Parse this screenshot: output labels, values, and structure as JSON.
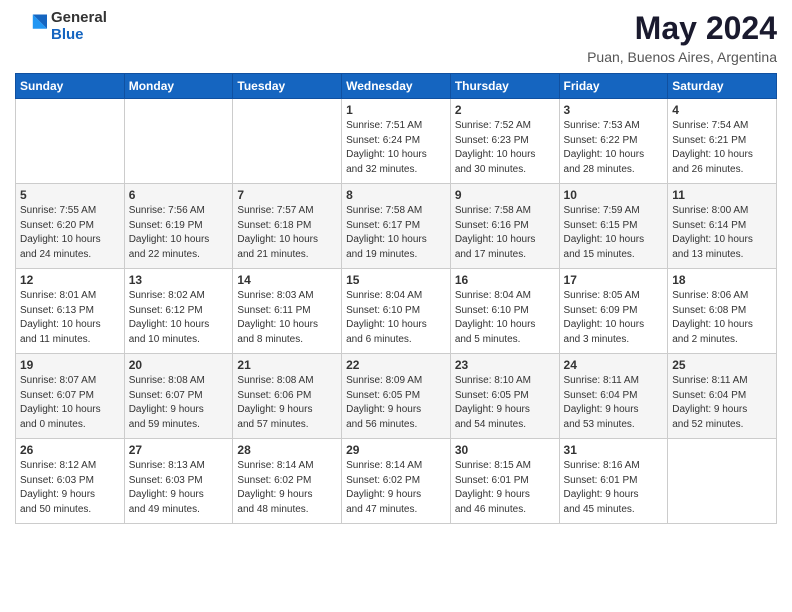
{
  "logo": {
    "general": "General",
    "blue": "Blue"
  },
  "title": "May 2024",
  "location": "Puan, Buenos Aires, Argentina",
  "days_of_week": [
    "Sunday",
    "Monday",
    "Tuesday",
    "Wednesday",
    "Thursday",
    "Friday",
    "Saturday"
  ],
  "weeks": [
    [
      {
        "day": "",
        "info": ""
      },
      {
        "day": "",
        "info": ""
      },
      {
        "day": "",
        "info": ""
      },
      {
        "day": "1",
        "info": "Sunrise: 7:51 AM\nSunset: 6:24 PM\nDaylight: 10 hours\nand 32 minutes."
      },
      {
        "day": "2",
        "info": "Sunrise: 7:52 AM\nSunset: 6:23 PM\nDaylight: 10 hours\nand 30 minutes."
      },
      {
        "day": "3",
        "info": "Sunrise: 7:53 AM\nSunset: 6:22 PM\nDaylight: 10 hours\nand 28 minutes."
      },
      {
        "day": "4",
        "info": "Sunrise: 7:54 AM\nSunset: 6:21 PM\nDaylight: 10 hours\nand 26 minutes."
      }
    ],
    [
      {
        "day": "5",
        "info": "Sunrise: 7:55 AM\nSunset: 6:20 PM\nDaylight: 10 hours\nand 24 minutes."
      },
      {
        "day": "6",
        "info": "Sunrise: 7:56 AM\nSunset: 6:19 PM\nDaylight: 10 hours\nand 22 minutes."
      },
      {
        "day": "7",
        "info": "Sunrise: 7:57 AM\nSunset: 6:18 PM\nDaylight: 10 hours\nand 21 minutes."
      },
      {
        "day": "8",
        "info": "Sunrise: 7:58 AM\nSunset: 6:17 PM\nDaylight: 10 hours\nand 19 minutes."
      },
      {
        "day": "9",
        "info": "Sunrise: 7:58 AM\nSunset: 6:16 PM\nDaylight: 10 hours\nand 17 minutes."
      },
      {
        "day": "10",
        "info": "Sunrise: 7:59 AM\nSunset: 6:15 PM\nDaylight: 10 hours\nand 15 minutes."
      },
      {
        "day": "11",
        "info": "Sunrise: 8:00 AM\nSunset: 6:14 PM\nDaylight: 10 hours\nand 13 minutes."
      }
    ],
    [
      {
        "day": "12",
        "info": "Sunrise: 8:01 AM\nSunset: 6:13 PM\nDaylight: 10 hours\nand 11 minutes."
      },
      {
        "day": "13",
        "info": "Sunrise: 8:02 AM\nSunset: 6:12 PM\nDaylight: 10 hours\nand 10 minutes."
      },
      {
        "day": "14",
        "info": "Sunrise: 8:03 AM\nSunset: 6:11 PM\nDaylight: 10 hours\nand 8 minutes."
      },
      {
        "day": "15",
        "info": "Sunrise: 8:04 AM\nSunset: 6:10 PM\nDaylight: 10 hours\nand 6 minutes."
      },
      {
        "day": "16",
        "info": "Sunrise: 8:04 AM\nSunset: 6:10 PM\nDaylight: 10 hours\nand 5 minutes."
      },
      {
        "day": "17",
        "info": "Sunrise: 8:05 AM\nSunset: 6:09 PM\nDaylight: 10 hours\nand 3 minutes."
      },
      {
        "day": "18",
        "info": "Sunrise: 8:06 AM\nSunset: 6:08 PM\nDaylight: 10 hours\nand 2 minutes."
      }
    ],
    [
      {
        "day": "19",
        "info": "Sunrise: 8:07 AM\nSunset: 6:07 PM\nDaylight: 10 hours\nand 0 minutes."
      },
      {
        "day": "20",
        "info": "Sunrise: 8:08 AM\nSunset: 6:07 PM\nDaylight: 9 hours\nand 59 minutes."
      },
      {
        "day": "21",
        "info": "Sunrise: 8:08 AM\nSunset: 6:06 PM\nDaylight: 9 hours\nand 57 minutes."
      },
      {
        "day": "22",
        "info": "Sunrise: 8:09 AM\nSunset: 6:05 PM\nDaylight: 9 hours\nand 56 minutes."
      },
      {
        "day": "23",
        "info": "Sunrise: 8:10 AM\nSunset: 6:05 PM\nDaylight: 9 hours\nand 54 minutes."
      },
      {
        "day": "24",
        "info": "Sunrise: 8:11 AM\nSunset: 6:04 PM\nDaylight: 9 hours\nand 53 minutes."
      },
      {
        "day": "25",
        "info": "Sunrise: 8:11 AM\nSunset: 6:04 PM\nDaylight: 9 hours\nand 52 minutes."
      }
    ],
    [
      {
        "day": "26",
        "info": "Sunrise: 8:12 AM\nSunset: 6:03 PM\nDaylight: 9 hours\nand 50 minutes."
      },
      {
        "day": "27",
        "info": "Sunrise: 8:13 AM\nSunset: 6:03 PM\nDaylight: 9 hours\nand 49 minutes."
      },
      {
        "day": "28",
        "info": "Sunrise: 8:14 AM\nSunset: 6:02 PM\nDaylight: 9 hours\nand 48 minutes."
      },
      {
        "day": "29",
        "info": "Sunrise: 8:14 AM\nSunset: 6:02 PM\nDaylight: 9 hours\nand 47 minutes."
      },
      {
        "day": "30",
        "info": "Sunrise: 8:15 AM\nSunset: 6:01 PM\nDaylight: 9 hours\nand 46 minutes."
      },
      {
        "day": "31",
        "info": "Sunrise: 8:16 AM\nSunset: 6:01 PM\nDaylight: 9 hours\nand 45 minutes."
      },
      {
        "day": "",
        "info": ""
      }
    ]
  ]
}
